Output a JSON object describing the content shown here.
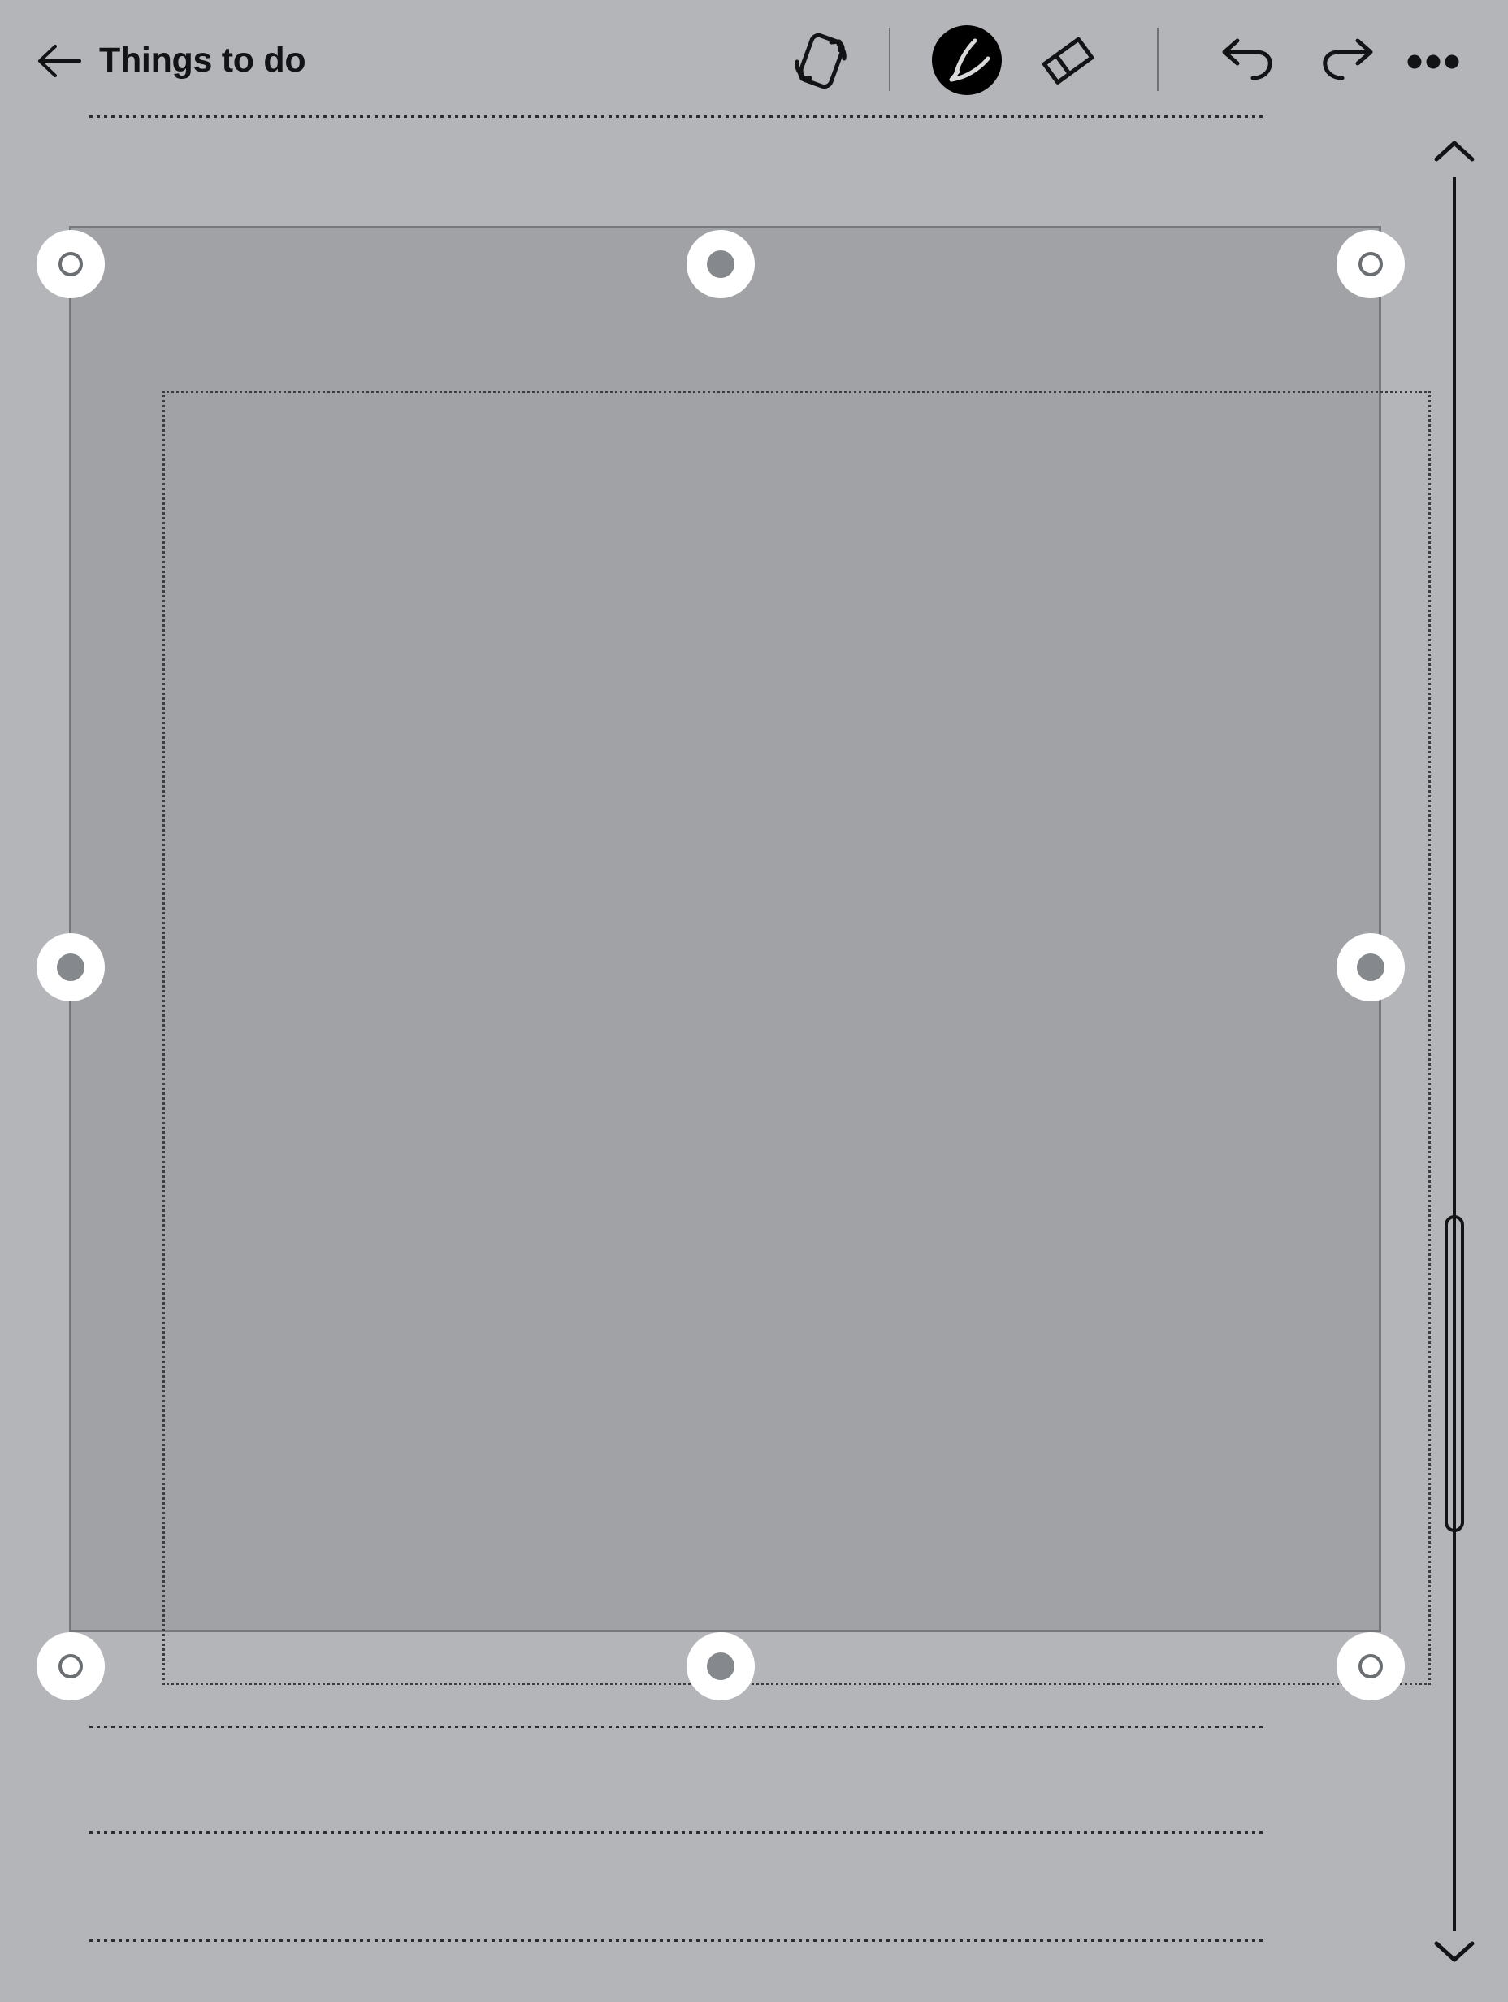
{
  "app": {
    "background_color": "#b3b5b9",
    "accent_color": "#000000"
  },
  "header": {
    "back_label": "back-arrow",
    "title": "Things to do",
    "tools": [
      {
        "id": "rotate-page",
        "name": "rotate-page-icon",
        "label": "Rotate page",
        "selected": false
      },
      {
        "id": "pen",
        "name": "pen-icon",
        "label": "Pen",
        "selected": true
      },
      {
        "id": "eraser",
        "name": "eraser-icon",
        "label": "Eraser",
        "selected": false
      },
      {
        "id": "undo",
        "name": "undo-icon",
        "label": "Undo",
        "selected": false
      },
      {
        "id": "redo",
        "name": "redo-icon",
        "label": "Redo",
        "selected": false
      },
      {
        "id": "more",
        "name": "more-options-icon",
        "label": "More options",
        "selected": false
      }
    ]
  },
  "canvas": {
    "selection": {
      "state": "active",
      "fill_color": "#a0a2a6",
      "border_color": "#75787c",
      "inner_dash_color": "#3a3c40",
      "handles": [
        {
          "id": "top-left",
          "type": "corner",
          "label": "Resize top left"
        },
        {
          "id": "top-center",
          "type": "edge",
          "label": "Resize top"
        },
        {
          "id": "top-right",
          "type": "corner",
          "label": "Resize top right"
        },
        {
          "id": "middle-left",
          "type": "edge",
          "label": "Resize left"
        },
        {
          "id": "middle-right",
          "type": "edge",
          "label": "Resize right"
        },
        {
          "id": "bottom-left",
          "type": "corner",
          "label": "Resize bottom left"
        },
        {
          "id": "bottom-center",
          "type": "edge",
          "label": "Resize bottom"
        },
        {
          "id": "bottom-right",
          "type": "corner",
          "label": "Resize bottom right"
        }
      ]
    },
    "ruled_lines": [
      {
        "id": "ruled-line-1"
      },
      {
        "id": "ruled-line-2"
      },
      {
        "id": "ruled-line-3"
      }
    ]
  },
  "scrollbar": {
    "up_label": "chevron-up",
    "down_label": "chevron-down",
    "orientation": "vertical"
  }
}
